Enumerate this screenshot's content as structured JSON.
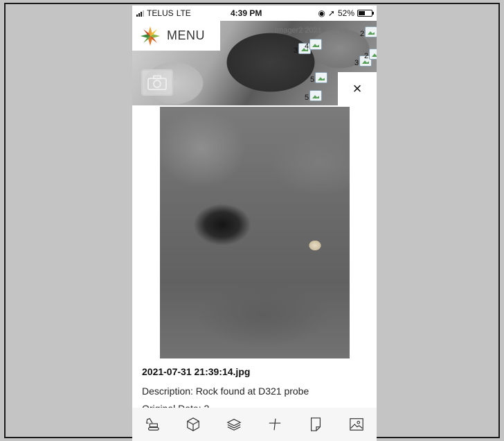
{
  "status_bar": {
    "carrier": "TELUS",
    "network": "LTE",
    "time": "4:39 PM",
    "battery": "52%",
    "battery_level": 0.52
  },
  "map": {
    "menu_label": "MENU",
    "layer_label": "Imager2 2021_03_12",
    "pins": [
      {
        "count": "3"
      },
      {
        "count": "4"
      },
      {
        "count": "3"
      },
      {
        "count": "2"
      },
      {
        "count": "5"
      },
      {
        "count": "5"
      },
      {
        "count": "2"
      }
    ]
  },
  "close_label": "×",
  "photo": {
    "filename": "2021-07-31 21:39:14.jpg",
    "description": "Description: Rock found at D321 probe",
    "partial_line": "Original Date: 2"
  },
  "toolbar": {
    "items": [
      {
        "icon": "excavator-icon"
      },
      {
        "icon": "cube-icon"
      },
      {
        "icon": "layers-icon"
      },
      {
        "icon": "crosshair-icon"
      },
      {
        "icon": "document-icon"
      },
      {
        "icon": "image-icon"
      }
    ]
  }
}
